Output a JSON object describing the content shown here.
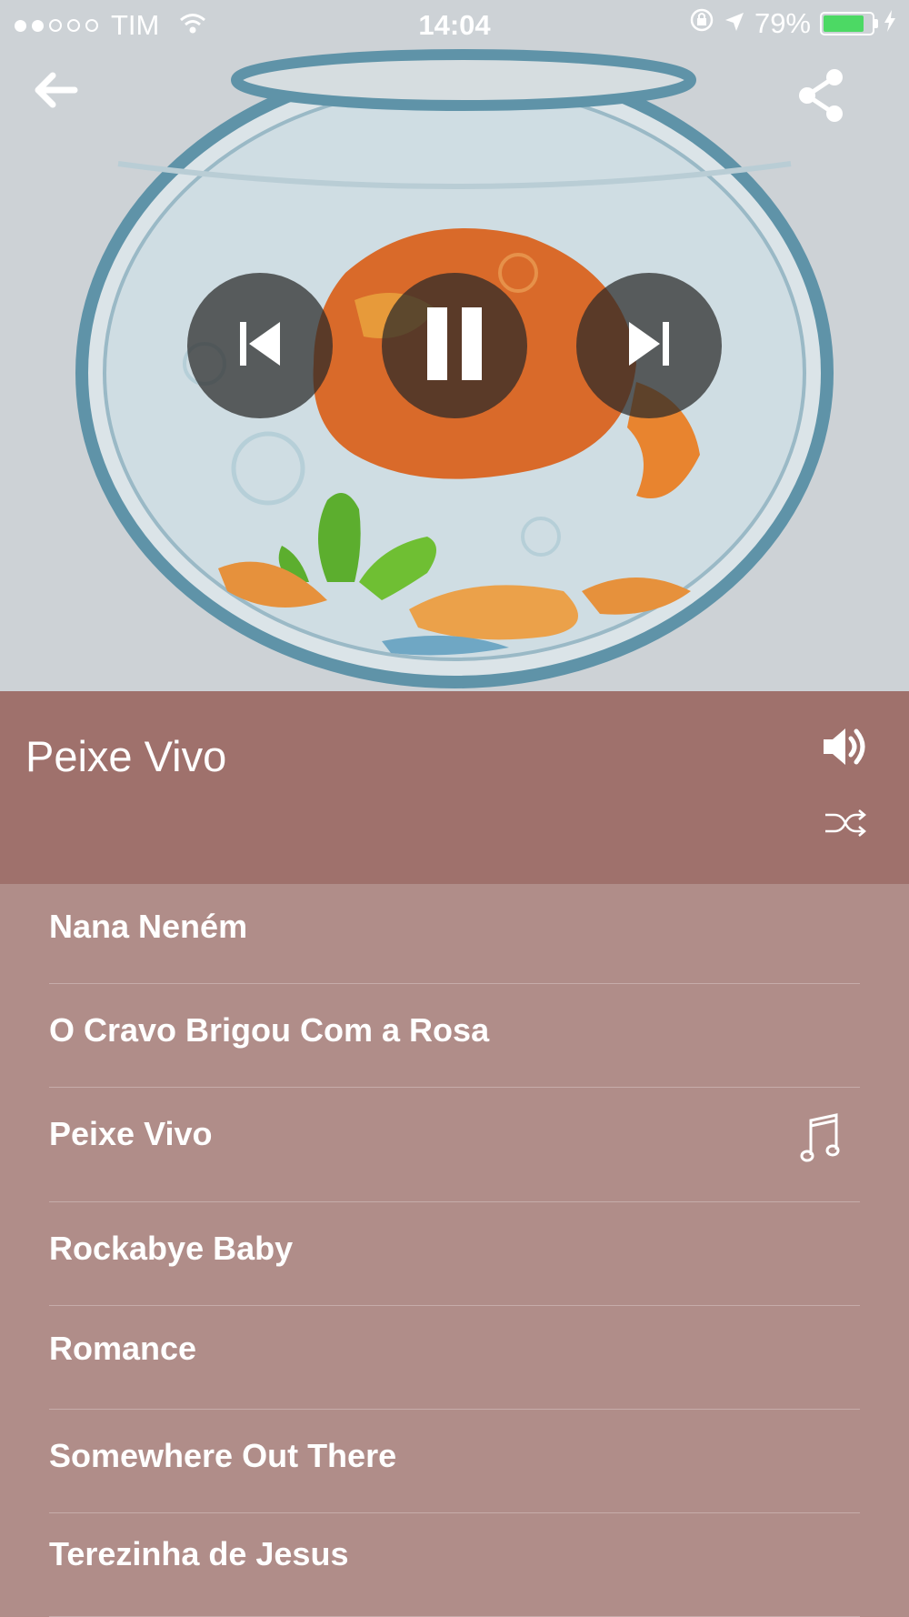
{
  "status_bar": {
    "signal_dots_filled": 2,
    "signal_dots_total": 5,
    "carrier": "TIM",
    "time": "14:04",
    "battery_percent": "79%",
    "battery_level": 0.79,
    "battery_color": "#4cd964",
    "icons": [
      "wifi-icon",
      "rotation-lock-icon",
      "location-arrow-icon",
      "charging-bolt-icon"
    ]
  },
  "toolbar": {
    "back_icon": "back-arrow-icon",
    "share_icon": "share-icon"
  },
  "player": {
    "prev_icon": "skip-previous-icon",
    "pause_icon": "pause-icon",
    "next_icon": "skip-next-icon"
  },
  "now_playing": {
    "title": "Peixe Vivo",
    "volume_icon": "volume-icon",
    "shuffle_icon": "shuffle-icon",
    "header_color": "#9f716c"
  },
  "playlist": {
    "background_color": "#b08d89",
    "items": [
      {
        "label": "Nana Neném",
        "playing": false
      },
      {
        "label": "O Cravo Brigou Com a Rosa",
        "playing": false
      },
      {
        "label": "Peixe Vivo",
        "playing": true
      },
      {
        "label": "Rockabye Baby",
        "playing": false
      },
      {
        "label": "Romance",
        "playing": false
      },
      {
        "label": "Somewhere Out There",
        "playing": false
      },
      {
        "label": "Terezinha de Jesus",
        "playing": false
      }
    ],
    "playing_icon": "music-note-icon"
  }
}
